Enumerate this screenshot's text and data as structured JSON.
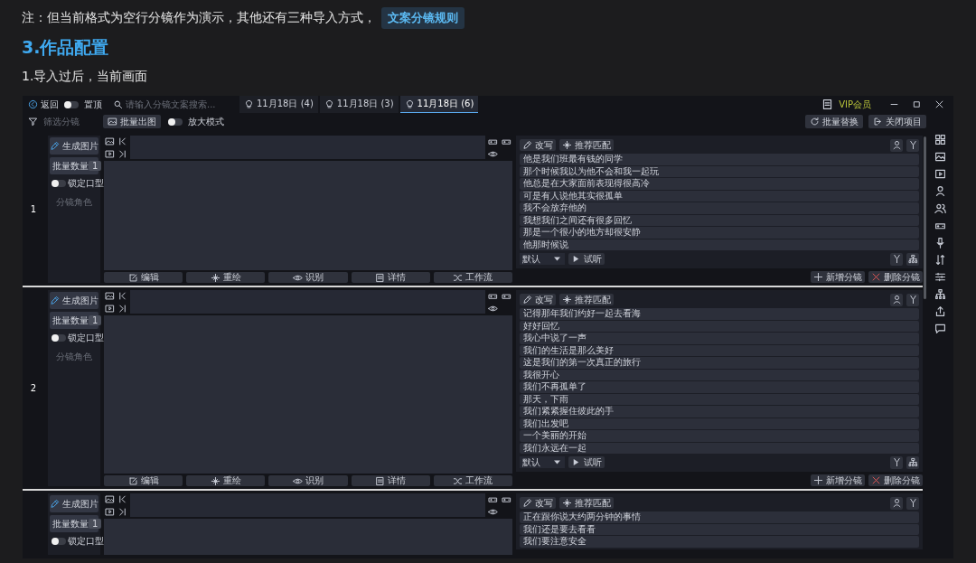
{
  "note": {
    "text": "注：但当前格式为空行分镜作为演示，其他还有三种导入方式，",
    "link": "文案分镜规则"
  },
  "heading": "3.作品配置",
  "subheading": "1.导入过后，当前画面",
  "app": {
    "back": "返回",
    "pin_toggle": {
      "label": "置顶",
      "on": false
    },
    "search": {
      "placeholder": "请输入分镜文案搜索..."
    },
    "tabs": [
      {
        "label": "11月18日 (4)",
        "selected": false
      },
      {
        "label": "11月18日 (3)",
        "selected": false
      },
      {
        "label": "11月18日 (6)",
        "selected": true
      }
    ],
    "vip": "VIP会员",
    "filter": "筛选分镜",
    "batch_button": "批量出图",
    "zoom_toggle": {
      "label": "放大模式",
      "on": false
    },
    "replace_button": "批量替换",
    "close_button": "关闭项目",
    "shots": [
      {
        "number": "1",
        "generate": "生成图片",
        "count_label": "批量数量",
        "count": "1",
        "lip_toggle": {
          "label": "锁定口型",
          "on": false
        },
        "hint": "分镜角色",
        "actions": [
          "编辑",
          "重绘",
          "识别",
          "详情",
          "工作流"
        ],
        "rewrite": "改写",
        "match": "推荐匹配",
        "lines": [
          "他是我们班最有钱的同学",
          "那个时候我以为他不会和我一起玩",
          "他总是在大家面前表现得很高冷",
          "可是有人说他其实很孤单",
          "我不会放弃他的",
          "我想我们之间还有很多回忆",
          "那是一个很小的地方却很安静",
          "他那时候说"
        ],
        "voice": "默认",
        "preview": "试听",
        "add": "新增分镜",
        "delete": "删除分镜"
      },
      {
        "number": "2",
        "generate": "生成图片",
        "count_label": "批量数量",
        "count": "1",
        "lip_toggle": {
          "label": "锁定口型",
          "on": false
        },
        "hint": "分镜角色",
        "actions": [
          "编辑",
          "重绘",
          "识别",
          "详情",
          "工作流"
        ],
        "rewrite": "改写",
        "match": "推荐匹配",
        "lines": [
          "记得那年我们约好一起去看海",
          "好好回忆",
          "我心中说了一声",
          "我们的生活是那么美好",
          "这是我们的第一次真正的旅行",
          "我很开心",
          "我们不再孤单了",
          "那天，下雨",
          "我们紧紧握住彼此的手",
          "我们出发吧",
          "一个美丽的开始",
          "我们永远在一起"
        ],
        "voice": "默认",
        "preview": "试听",
        "add": "新增分镜",
        "delete": "删除分镜"
      },
      {
        "generate": "生成图片",
        "count_label": "批量数量",
        "count": "1",
        "lip_toggle": {
          "label": "锁定口型",
          "on": false
        },
        "rewrite": "改写",
        "match": "推荐匹配",
        "lines": [
          "正在跟你说大约两分钟的事情",
          "我们还是要去看看",
          "我们要注意安全"
        ]
      }
    ]
  }
}
